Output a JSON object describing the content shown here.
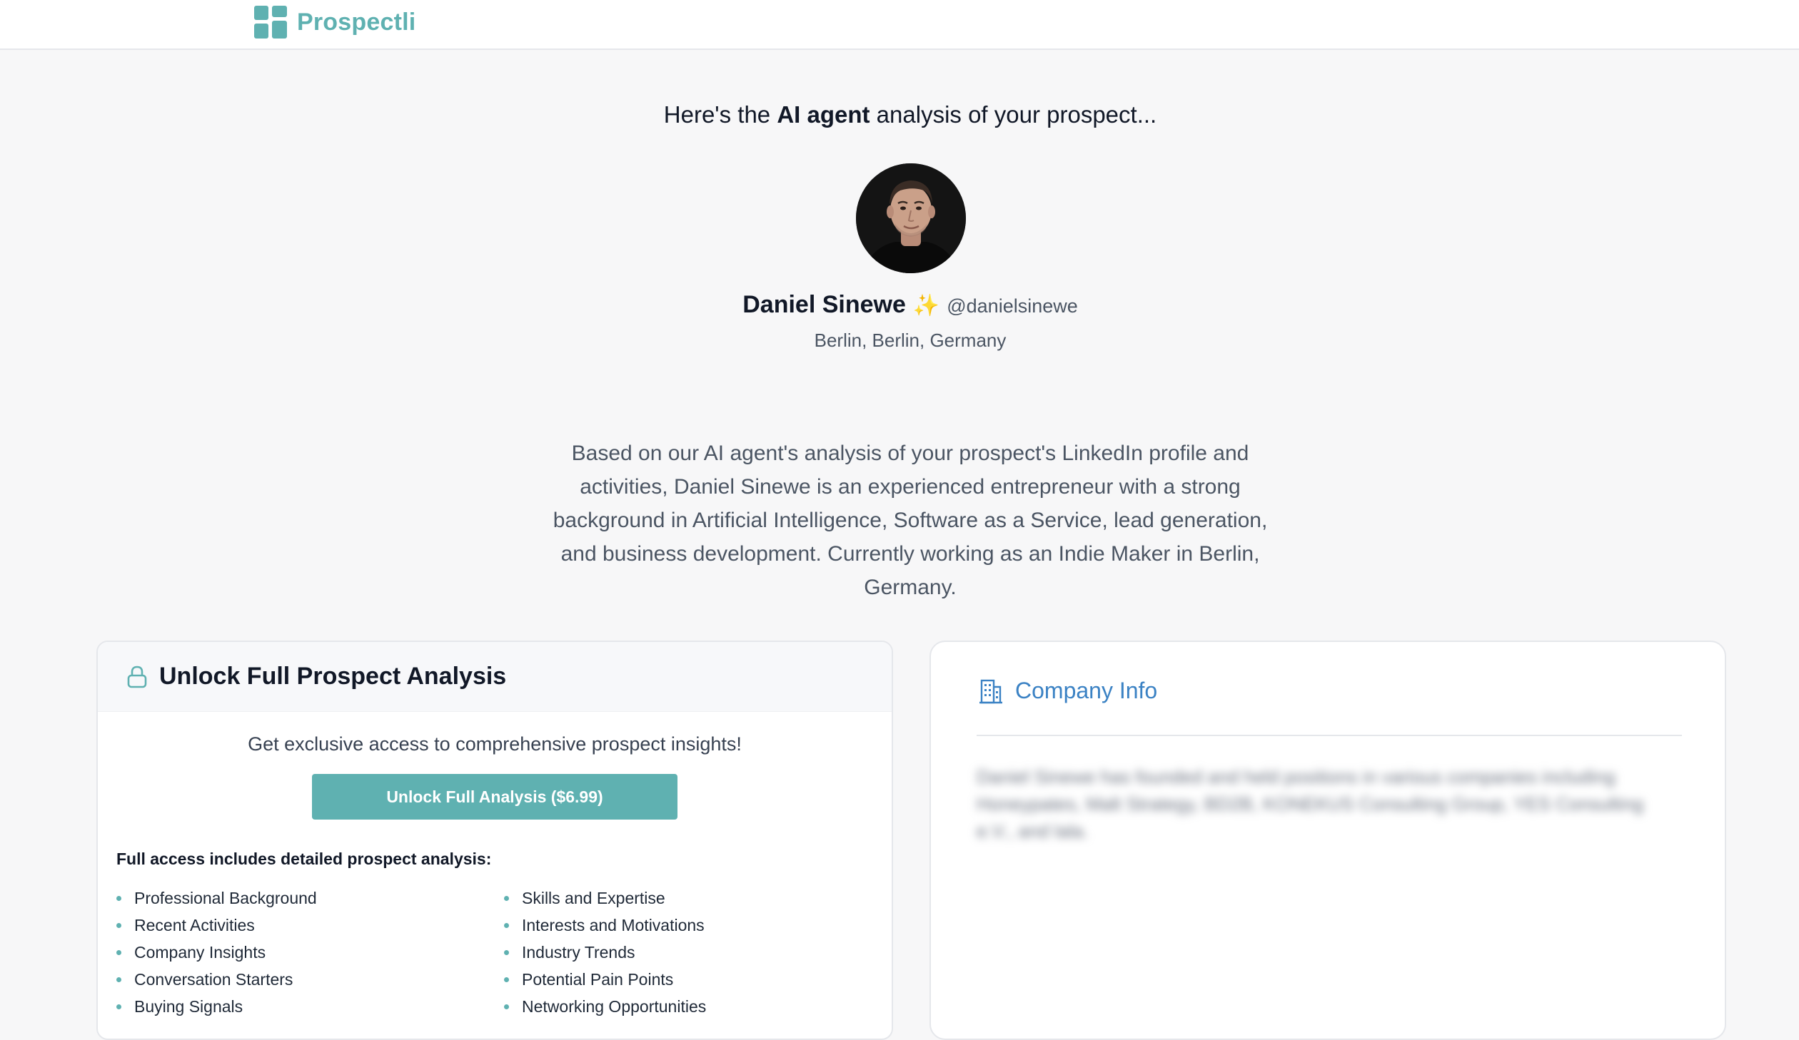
{
  "header": {
    "brand": "Prospectli",
    "brand_color": "#5fb1b1"
  },
  "hero": {
    "heading_prefix": "Here's the ",
    "heading_bold": "AI agent",
    "heading_suffix": " analysis of your prospect..."
  },
  "prospect": {
    "name": "Daniel Sinewe",
    "badge": "✨",
    "handle": "@danielsinewe",
    "location": "Berlin, Berlin, Germany",
    "avatar_icon": "profile-photo"
  },
  "summary": "Based on our AI agent's analysis of your prospect's LinkedIn profile and activities, Daniel Sinewe is an experienced entrepreneur with a strong background in Artificial Intelligence, Software as a Service, lead generation, and business development. Currently working as an Indie Maker in Berlin, Germany.",
  "unlock": {
    "title": "Unlock Full Prospect Analysis",
    "subtitle": "Get exclusive access to comprehensive prospect insights!",
    "button_label": "Unlock Full Analysis ($6.99)",
    "includes_heading": "Full access includes detailed prospect analysis:",
    "features_left": [
      "Professional Background",
      "Recent Activities",
      "Company Insights",
      "Conversation Starters",
      "Buying Signals"
    ],
    "features_right": [
      "Skills and Expertise",
      "Interests and Motivations",
      "Industry Trends",
      "Potential Pain Points",
      "Networking Opportunities"
    ],
    "accent_color": "#5fb1b1"
  },
  "company": {
    "title": "Company Info",
    "title_color": "#3b82c4",
    "text": "Daniel Sinewe has founded and held positions in various companies including Honeypates, Malt Strategy, BD2B, KONEKUS Consulting Group, YES Consulting e.V., and lala."
  }
}
